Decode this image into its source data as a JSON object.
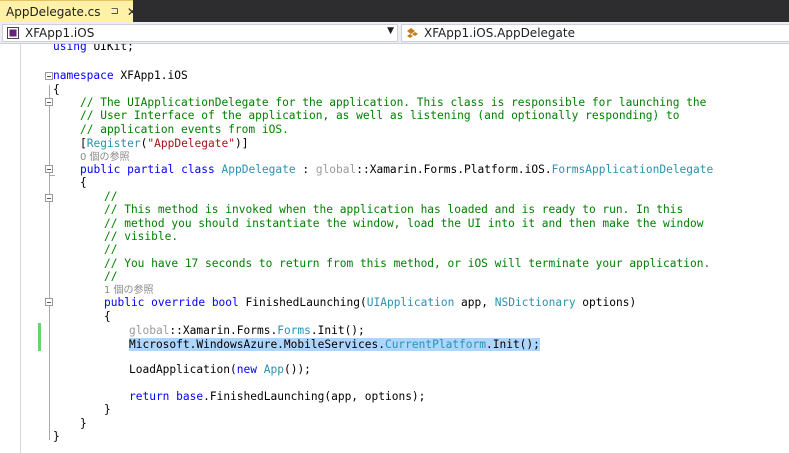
{
  "tab": {
    "title": "AppDelegate.cs",
    "pin_glyph": "⊐",
    "close_glyph": "✕"
  },
  "nav": {
    "project": "XFApp1.iOS",
    "member": "XFApp1.iOS.AppDelegate"
  },
  "code": {
    "using_kw": "using",
    "using_ns": "UIKit;",
    "ns_kw": "namespace",
    "ns_name": " XFApp1.iOS",
    "brace_open": "{",
    "brace_close": "}",
    "comment1": "// The UIApplicationDelegate for the application. This class is responsible for launching the",
    "comment2": "// User Interface of the application, as well as listening (and optionally responding) to",
    "comment3": "// application events from iOS.",
    "attr_open": "[",
    "attr_name": "Register",
    "attr_paren": "(",
    "attr_string": "\"AppDelegate\"",
    "attr_close": ")]",
    "refcount0": "0 個の参照",
    "cls_public": "public",
    "cls_partial": "partial",
    "cls_class": "class",
    "cls_name": "AppDelegate",
    "cls_colon": " : ",
    "cls_global": "global",
    "cls_ns": "::Xamarin.Forms.Platform.iOS.",
    "cls_base": "FormsApplicationDelegate",
    "c_slashes": "//",
    "m_comment1": "// This method is invoked when the application has loaded and is ready to run. In this",
    "m_comment2": "// method you should instantiate the window, load the UI into it and then make the window",
    "m_comment3": "// visible.",
    "m_comment4": "// You have 17 seconds to return from this method, or iOS will terminate your application.",
    "refcount1": "1 個の参照",
    "m_public": "public",
    "m_override": "override",
    "m_bool": "bool",
    "m_name": " FinishedLaunching(",
    "m_p1type": "UIApplication",
    "m_p1": " app, ",
    "m_p2type": "NSDictionary",
    "m_p2": " options)",
    "l1_global": "global",
    "l1_ns": "::Xamarin.Forms.",
    "l1_type": "Forms",
    "l1_call": ".Init();",
    "l2_ns": "Microsoft.WindowsAzure.MobileServices.",
    "l2_type": "CurrentPlatform",
    "l2_call": ".Init();",
    "l3_pre": "LoadApplication(",
    "l3_new": "new",
    "l3_type": "App",
    "l3_post": "());",
    "l4_kw": "return",
    "l4_base": "base",
    "l4_rest": ".FinishedLaunching(app, options);"
  }
}
